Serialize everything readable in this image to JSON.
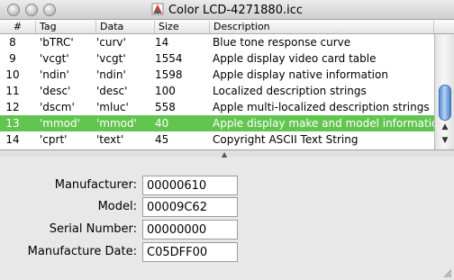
{
  "window": {
    "title": "Color LCD-4271880.icc"
  },
  "table": {
    "columns": [
      "#",
      "Tag",
      "Data",
      "Size",
      "Description"
    ],
    "rows": [
      {
        "num": "8",
        "tag": "'bTRC'",
        "data": "'curv'",
        "size": "14",
        "desc": "Blue tone response curve",
        "selected": false
      },
      {
        "num": "9",
        "tag": "'vcgt'",
        "data": "'vcgt'",
        "size": "1554",
        "desc": "Apple display video card table",
        "selected": false
      },
      {
        "num": "10",
        "tag": "'ndin'",
        "data": "'ndin'",
        "size": "1598",
        "desc": "Apple display native information",
        "selected": false
      },
      {
        "num": "11",
        "tag": "'desc'",
        "data": "'desc'",
        "size": "100",
        "desc": "Localized description strings",
        "selected": false
      },
      {
        "num": "12",
        "tag": "'dscm'",
        "data": "'mluc'",
        "size": "558",
        "desc": "Apple multi-localized description strings",
        "selected": false
      },
      {
        "num": "13",
        "tag": "'mmod'",
        "data": "'mmod'",
        "size": "40",
        "desc": "Apple display make and model informatio",
        "selected": true
      },
      {
        "num": "14",
        "tag": "'cprt'",
        "data": "'text'",
        "size": "45",
        "desc": "Copyright ASCII Text String",
        "selected": false
      }
    ],
    "selected_color": "#62c54f",
    "scrollbar_color": "#5a8ed6"
  },
  "form": {
    "fields": [
      {
        "label": "Manufacturer:",
        "value": "00000610"
      },
      {
        "label": "Model:",
        "value": "00009C62"
      },
      {
        "label": "Serial Number:",
        "value": "00000000"
      },
      {
        "label": "Manufacture Date:",
        "value": "C05DFF00"
      }
    ]
  }
}
